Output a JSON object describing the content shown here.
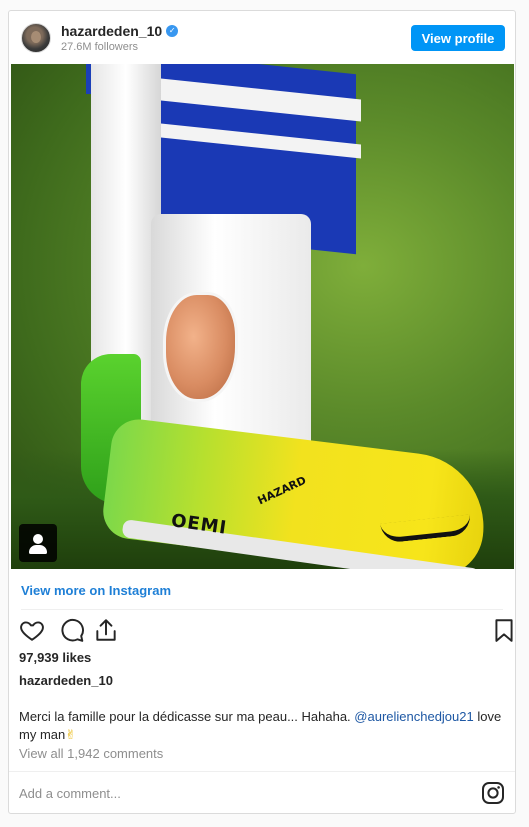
{
  "post": {
    "username": "hazardeden_10",
    "followers": "27.6M followers",
    "view_profile_label": "View profile",
    "image": {
      "brand_text": "OEMI",
      "name_text": "HAZARD"
    },
    "view_more_label": "View more on Instagram",
    "likes": "97,939 likes",
    "owner": "hazardeden_10",
    "caption_text": "Merci la famille pour la dédicasse sur ma peau... Hahaha. ",
    "caption_mention": "@aurelienchedjou21",
    "caption_end": " love my man",
    "caption_emoji": "✌",
    "view_comments": "View all 1,942 comments",
    "comment_placeholder": "Add a comment..."
  },
  "colors": {
    "accent": "#0095f6",
    "link": "#1e7fd6",
    "verified": "#3897f0"
  },
  "icons": [
    "heart-icon",
    "comment-icon",
    "share-icon",
    "bookmark-icon",
    "instagram-icon",
    "verified-icon",
    "user-tag-icon"
  ]
}
